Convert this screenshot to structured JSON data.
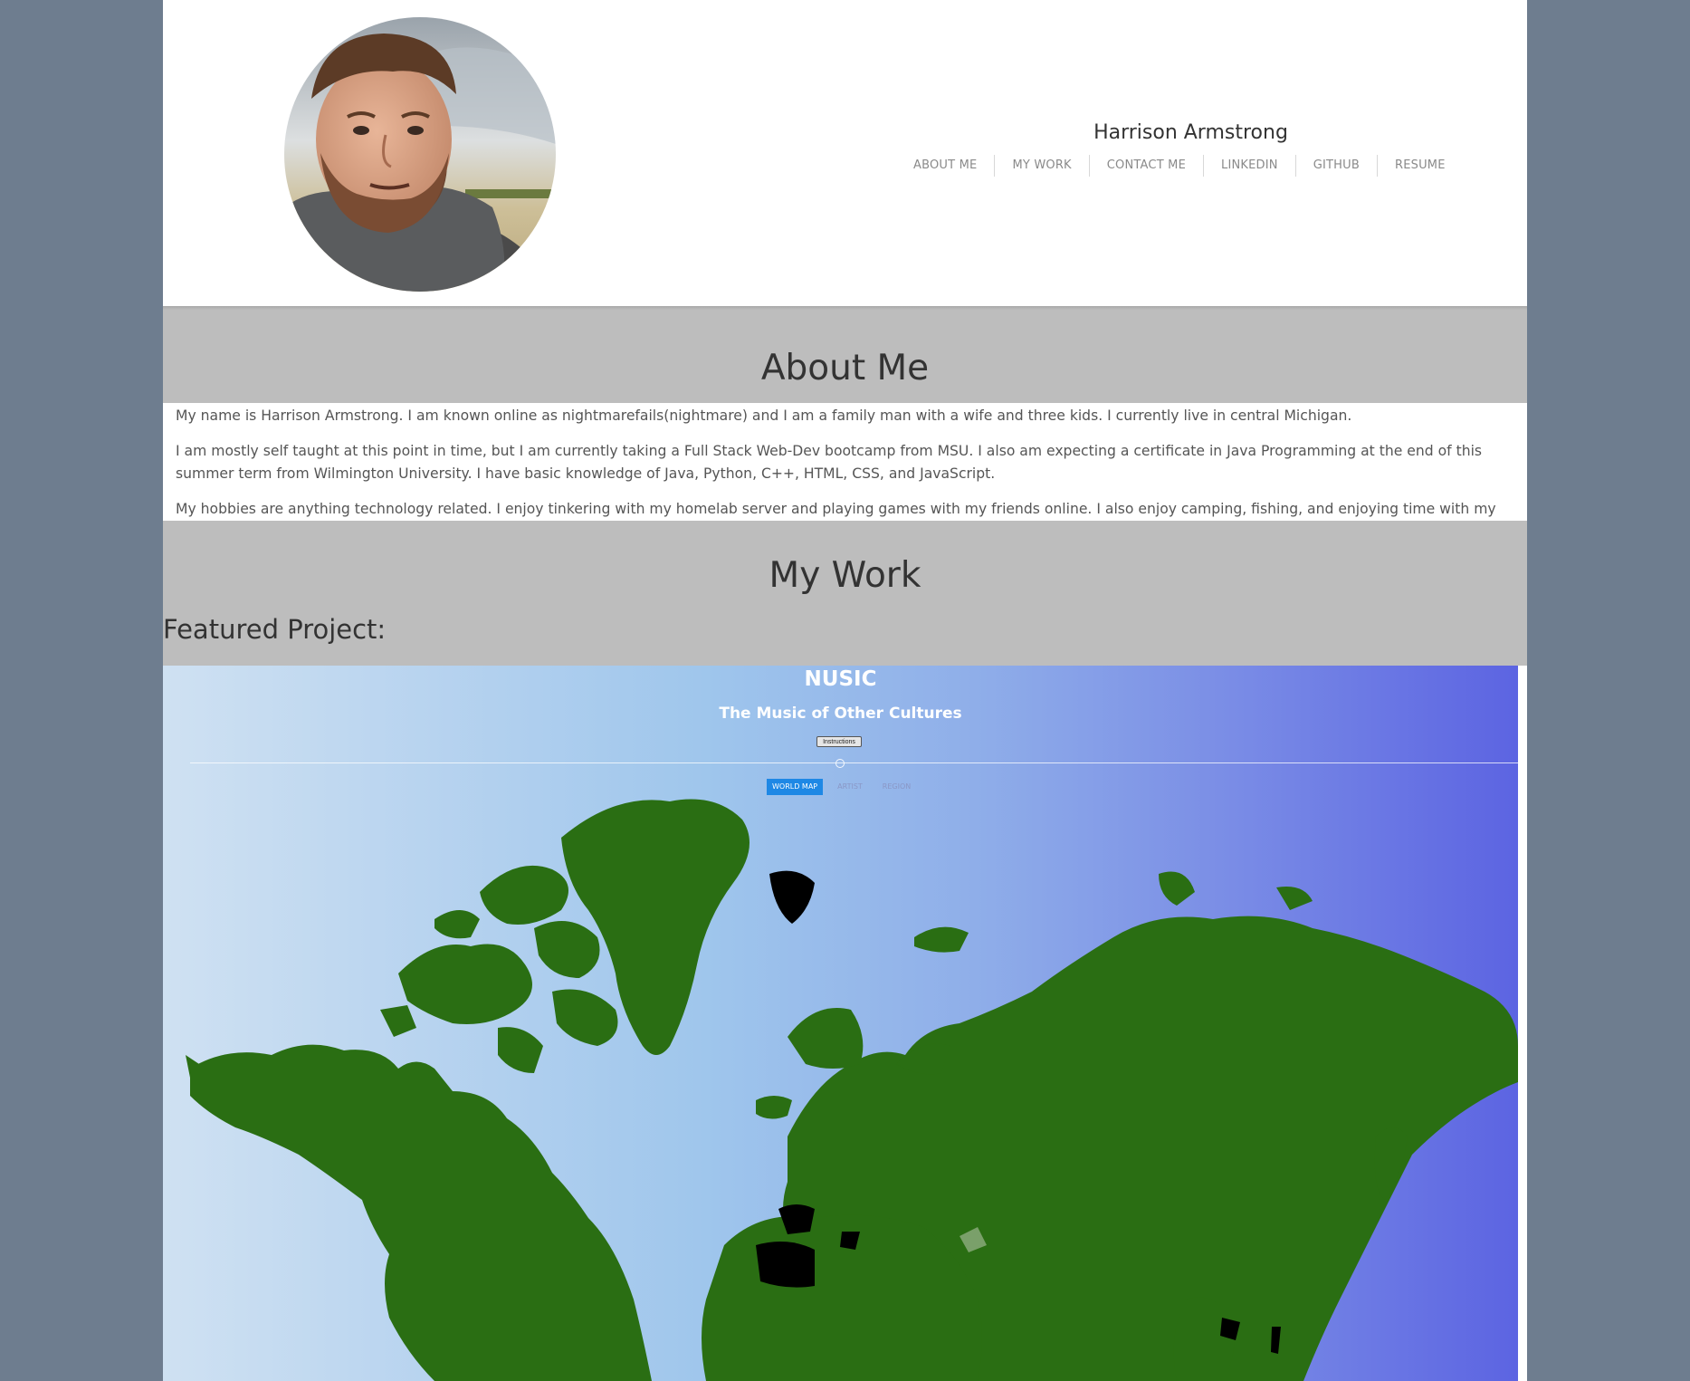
{
  "site": {
    "owner_name": "Harrison Armstrong",
    "nav": [
      {
        "label": "ABOUT ME"
      },
      {
        "label": "MY WORK"
      },
      {
        "label": "CONTACT ME"
      },
      {
        "label": "LINKEDIN"
      },
      {
        "label": "GITHUB"
      },
      {
        "label": "RESUME"
      }
    ]
  },
  "about": {
    "title": "About Me",
    "paragraphs": [
      "My name is Harrison Armstrong. I am known online as nightmarefails(nightmare) and I am a family man with a wife and three kids. I currently live in central Michigan.",
      "I am mostly self taught at this point in time, but I am currently taking a Full Stack Web-Dev bootcamp from MSU. I also am expecting a certificate in Java Programming at the end of this summer term from Wilmington University. I have basic knowledge of Java, Python, C++, HTML, CSS, and JavaScript.",
      "My hobbies are anything technology related. I enjoy tinkering with my homelab server and playing games with my friends online. I also enjoy camping, fishing, and enjoying time with my family."
    ]
  },
  "work": {
    "title": "My Work",
    "featured_label": "Featured Project:"
  },
  "project": {
    "title": "NUSIC",
    "subtitle": "The Music of Other Cultures",
    "instructions_button": "Instructions",
    "tabs": [
      {
        "label": "WORLD MAP",
        "active": true
      },
      {
        "label": "ARTIST",
        "active": false
      },
      {
        "label": "REGION",
        "active": false
      }
    ]
  },
  "colors": {
    "page_bg": "#6e7d8f",
    "band_gray": "#bdbdbd",
    "land_green": "#2a6e13",
    "tab_active": "#1e88e5"
  }
}
